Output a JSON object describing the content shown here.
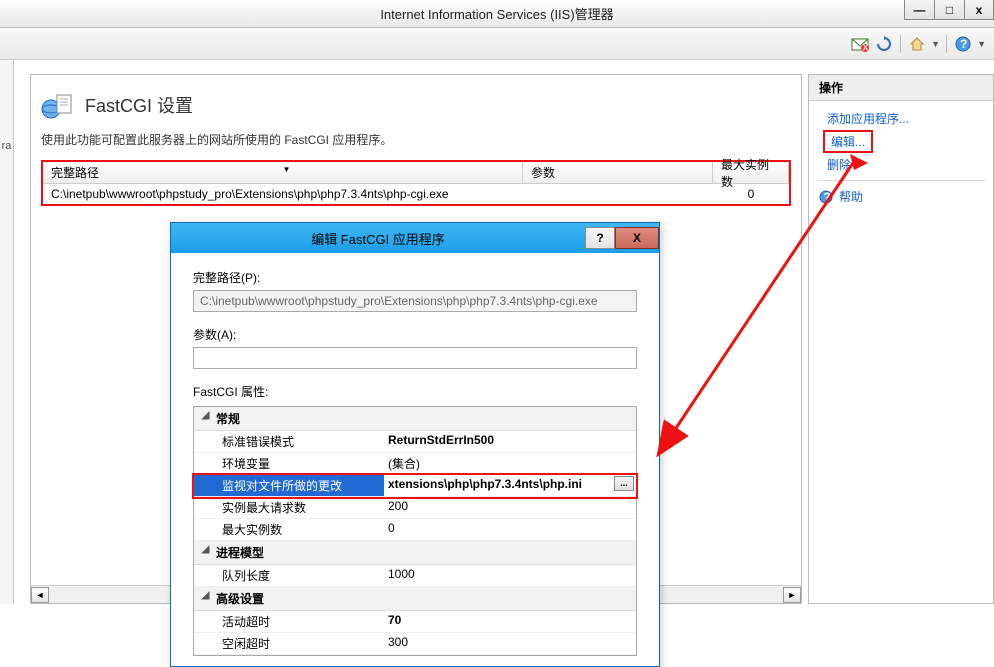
{
  "window": {
    "title": "Internet Information Services (IIS)管理器",
    "min": "—",
    "max": "□",
    "close": "x"
  },
  "left_edge_label": "ra",
  "page": {
    "title": "FastCGI 设置",
    "description": "使用此功能可配置此服务器上的网站所使用的 FastCGI 应用程序。"
  },
  "table": {
    "headers": {
      "path": "完整路径",
      "param": "参数",
      "max": "最大实例数"
    },
    "rows": [
      {
        "path": "C:\\inetpub\\wwwroot\\phpstudy_pro\\Extensions\\php\\php7.3.4nts\\php-cgi.exe",
        "param": "",
        "max": "0"
      }
    ]
  },
  "actions": {
    "header": "操作",
    "add": "添加应用程序...",
    "edit": "编辑...",
    "delete": "删除",
    "help": "帮助"
  },
  "dialog": {
    "title": "编辑 FastCGI 应用程序",
    "help_btn": "?",
    "close_btn": "X",
    "path_label": "完整路径(P):",
    "path_value": "C:\\inetpub\\wwwroot\\phpstudy_pro\\Extensions\\php\\php7.3.4nts\\php-cgi.exe",
    "args_label": "参数(A):",
    "args_value": "",
    "props_label": "FastCGI 属性:",
    "categories": {
      "general": "常规",
      "process": "进程模型",
      "advanced": "高级设置"
    },
    "props": {
      "std_err_mode": {
        "name": "标准错误模式",
        "value": "ReturnStdErrIn500"
      },
      "env_vars": {
        "name": "环境变量",
        "value": "(集合)"
      },
      "monitor_changes": {
        "name": "监视对文件所做的更改",
        "value": "xtensions\\php\\php7.3.4nts\\php.ini"
      },
      "max_requests": {
        "name": "实例最大请求数",
        "value": "200"
      },
      "max_instances": {
        "name": "最大实例数",
        "value": "0"
      },
      "queue_length": {
        "name": "队列长度",
        "value": "1000"
      },
      "activity_timeout": {
        "name": "活动超时",
        "value": "70"
      },
      "idle_timeout": {
        "name": "空闲超时",
        "value": "300"
      }
    },
    "browse": "..."
  }
}
